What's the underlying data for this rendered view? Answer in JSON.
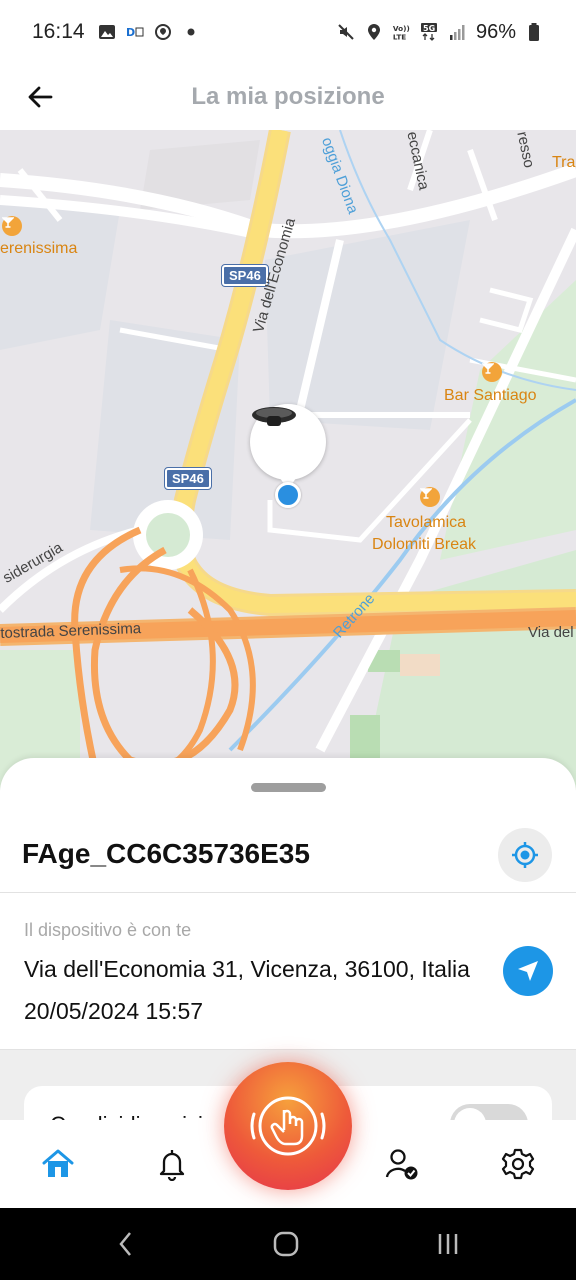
{
  "status_bar": {
    "time": "16:14",
    "battery": "96%",
    "icons_left": [
      "gallery-icon",
      "app-icon",
      "shield-icon",
      "dot-icon"
    ],
    "icons_right": [
      "mute-icon",
      "location-icon",
      "volte-icon",
      "5g-icon",
      "signal-icon",
      "battery-icon"
    ]
  },
  "header": {
    "title": "La mia posizione"
  },
  "map": {
    "labels": {
      "serenissima_left": "erenissima",
      "sp46_top": "SP46",
      "sp46_bottom": "SP46",
      "via_economia": "Via dell'Economia",
      "roggia_diona": "oggia Diona",
      "meccanica": "eccanica",
      "ressa": "resso",
      "tra": "Tra",
      "bar_santiago": "Bar Santiago",
      "tavolamica_1": "Tavolamica",
      "tavolamica_2": "Dolomiti Break",
      "siderurgia": "siderurgia",
      "tostrada": "tostrada Serenissima",
      "retrone": "Retrone",
      "via_del": "Via del"
    }
  },
  "sheet": {
    "device_name": "FAge_CC6C35736E35",
    "status": "Il dispositivo è con te",
    "address": "Via dell'Economia 31, Vicenza, 36100, Italia",
    "timestamp": "20/05/2024 15:57",
    "card_text": "Condividi posizione"
  },
  "colors": {
    "accent": "#1d96e6",
    "sos_start": "#f6a03c",
    "sos_end": "#e5334c",
    "title_grey": "#a5a9ae"
  }
}
